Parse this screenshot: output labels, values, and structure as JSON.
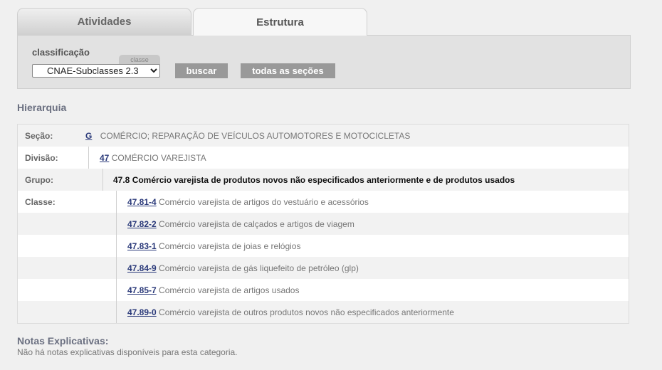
{
  "tabs": [
    {
      "label": "Atividades",
      "active": false
    },
    {
      "label": "Estrutura",
      "active": true
    }
  ],
  "search": {
    "label": "classificação",
    "select_tag": "classe",
    "selected": "CNAE-Subclasses 2.3",
    "buscar_label": "buscar",
    "todas_label": "todas as seções"
  },
  "hierarchy": {
    "title": "Hierarquia",
    "secao": {
      "label": "Seção:",
      "code": "G",
      "desc": "COMÉRCIO; REPARAÇÃO DE VEÍCULOS AUTOMOTORES E MOTOCICLETAS"
    },
    "divisao": {
      "label": "Divisão:",
      "code": "47",
      "desc": "COMÉRCIO VAREJISTA"
    },
    "grupo": {
      "label": "Grupo:",
      "text": "47.8 Comércio varejista de produtos novos não especificados anteriormente e de produtos usados"
    },
    "classe_label": "Classe:",
    "classes": [
      {
        "code": "47.81-4",
        "desc": "Comércio varejista de artigos do vestuário e acessórios"
      },
      {
        "code": "47.82-2",
        "desc": "Comércio varejista de calçados e artigos de viagem"
      },
      {
        "code": "47.83-1",
        "desc": "Comércio varejista de joias e relógios"
      },
      {
        "code": "47.84-9",
        "desc": "Comércio varejista de gás liquefeito de petróleo (glp)"
      },
      {
        "code": "47.85-7",
        "desc": "Comércio varejista de artigos usados"
      },
      {
        "code": "47.89-0",
        "desc": "Comércio varejista de outros produtos novos não especificados anteriormente"
      }
    ]
  },
  "notes": {
    "title": "Notas Explicativas:",
    "text": "Não há notas explicativas disponíveis para esta categoria."
  }
}
